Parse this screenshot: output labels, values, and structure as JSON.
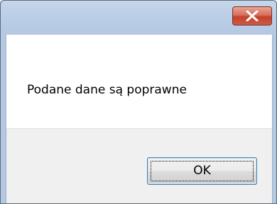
{
  "dialog": {
    "close_icon": "close-icon",
    "message": "Podane dane są poprawne",
    "ok_label": "OK"
  },
  "colors": {
    "close_button": "#c4412b",
    "ok_border": "#3c7fb1",
    "frame": "#b4c8e2"
  }
}
